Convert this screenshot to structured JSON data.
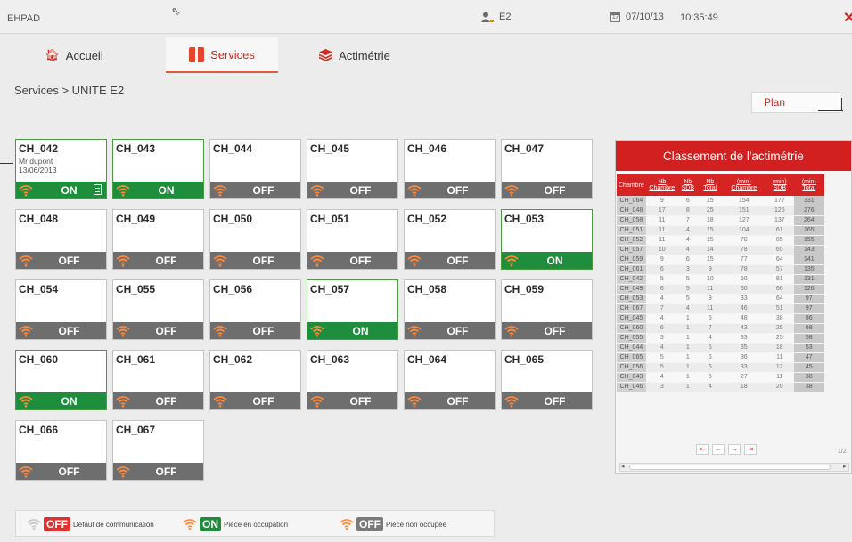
{
  "topbar": {
    "app_name": "EHPAD",
    "user_label": "E2",
    "date": "07/10/13",
    "calendar_day": "17",
    "time": "10:35:49",
    "close": "✕"
  },
  "tabs": [
    {
      "label": "Accueil",
      "icon": "home-icon"
    },
    {
      "label": "Services",
      "icon": "services-icon",
      "active": true
    },
    {
      "label": "Actimétrie",
      "icon": "layers-icon"
    }
  ],
  "breadcrumb": "Services > UNITE E2",
  "plan_button": "Plan",
  "colors": {
    "on": "#1e8e3c",
    "off": "#6e6e6e",
    "alert": "#e03030",
    "accent": "#d42424"
  },
  "rooms": [
    {
      "name": "CH_042",
      "status": "ON",
      "sub1": "Mr dupont",
      "sub2": "13/06/2013",
      "note": true
    },
    {
      "name": "CH_043",
      "status": "ON"
    },
    {
      "name": "CH_044",
      "status": "OFF"
    },
    {
      "name": "CH_045",
      "status": "OFF"
    },
    {
      "name": "CH_046",
      "status": "OFF"
    },
    {
      "name": "CH_047",
      "status": "OFF"
    },
    {
      "name": "CH_048",
      "status": "OFF"
    },
    {
      "name": "CH_049",
      "status": "OFF"
    },
    {
      "name": "CH_050",
      "status": "OFF"
    },
    {
      "name": "CH_051",
      "status": "OFF"
    },
    {
      "name": "CH_052",
      "status": "OFF"
    },
    {
      "name": "CH_053",
      "status": "ON"
    },
    {
      "name": "CH_054",
      "status": "OFF"
    },
    {
      "name": "CH_055",
      "status": "OFF"
    },
    {
      "name": "CH_056",
      "status": "OFF"
    },
    {
      "name": "CH_057",
      "status": "ON"
    },
    {
      "name": "CH_058",
      "status": "OFF"
    },
    {
      "name": "CH_059",
      "status": "OFF"
    },
    {
      "name": "CH_060",
      "status": "ON"
    },
    {
      "name": "CH_061",
      "status": "OFF"
    },
    {
      "name": "CH_062",
      "status": "OFF"
    },
    {
      "name": "CH_063",
      "status": "OFF"
    },
    {
      "name": "CH_064",
      "status": "OFF"
    },
    {
      "name": "CH_065",
      "status": "OFF"
    },
    {
      "name": "CH_066",
      "status": "OFF"
    },
    {
      "name": "CH_067",
      "status": "OFF"
    }
  ],
  "ranking": {
    "title": "Classement de l'actimétrie",
    "headers": [
      "Chambre",
      "Nb Chambre",
      "Nb SDB",
      "Nb Total",
      "(min) Chambre",
      "(min) SDB",
      "(min) Total"
    ],
    "rows": [
      [
        "CH_064",
        "9",
        "6",
        "15",
        "154",
        "177",
        "331"
      ],
      [
        "CH_048",
        "17",
        "8",
        "25",
        "151",
        "125",
        "276"
      ],
      [
        "CH_058",
        "11",
        "7",
        "18",
        "127",
        "137",
        "264"
      ],
      [
        "CH_051",
        "11",
        "4",
        "15",
        "104",
        "61",
        "165"
      ],
      [
        "CH_052",
        "11",
        "4",
        "15",
        "70",
        "85",
        "155"
      ],
      [
        "CH_057",
        "10",
        "4",
        "14",
        "78",
        "65",
        "143"
      ],
      [
        "CH_059",
        "9",
        "6",
        "15",
        "77",
        "64",
        "141"
      ],
      [
        "CH_061",
        "6",
        "3",
        "9",
        "78",
        "57",
        "135"
      ],
      [
        "CH_042",
        "5",
        "5",
        "10",
        "50",
        "81",
        "131"
      ],
      [
        "CH_049",
        "6",
        "5",
        "11",
        "60",
        "66",
        "126"
      ],
      [
        "CH_053",
        "4",
        "5",
        "9",
        "33",
        "64",
        "97"
      ],
      [
        "CH_067",
        "7",
        "4",
        "11",
        "46",
        "51",
        "97"
      ],
      [
        "CH_045",
        "4",
        "1",
        "5",
        "48",
        "38",
        "86"
      ],
      [
        "CH_060",
        "6",
        "1",
        "7",
        "43",
        "25",
        "68"
      ],
      [
        "CH_055",
        "3",
        "1",
        "4",
        "33",
        "25",
        "58"
      ],
      [
        "CH_044",
        "4",
        "1",
        "5",
        "35",
        "18",
        "53"
      ],
      [
        "CH_065",
        "5",
        "1",
        "6",
        "36",
        "11",
        "47"
      ],
      [
        "CH_056",
        "5",
        "1",
        "6",
        "33",
        "12",
        "45"
      ],
      [
        "CH_043",
        "4",
        "1",
        "5",
        "27",
        "11",
        "38"
      ],
      [
        "CH_046",
        "3",
        "1",
        "4",
        "18",
        "20",
        "38"
      ]
    ],
    "pager": [
      "⇤",
      "←",
      "→",
      "⇥"
    ],
    "page": "1/2"
  },
  "legend": [
    {
      "badge": "OFF",
      "text": "Défaut de communication",
      "style": "red"
    },
    {
      "badge": "ON",
      "text": "Pièce en occupation",
      "style": "green"
    },
    {
      "badge": "OFF",
      "text": "Pièce non occupée",
      "style": "grey"
    }
  ]
}
